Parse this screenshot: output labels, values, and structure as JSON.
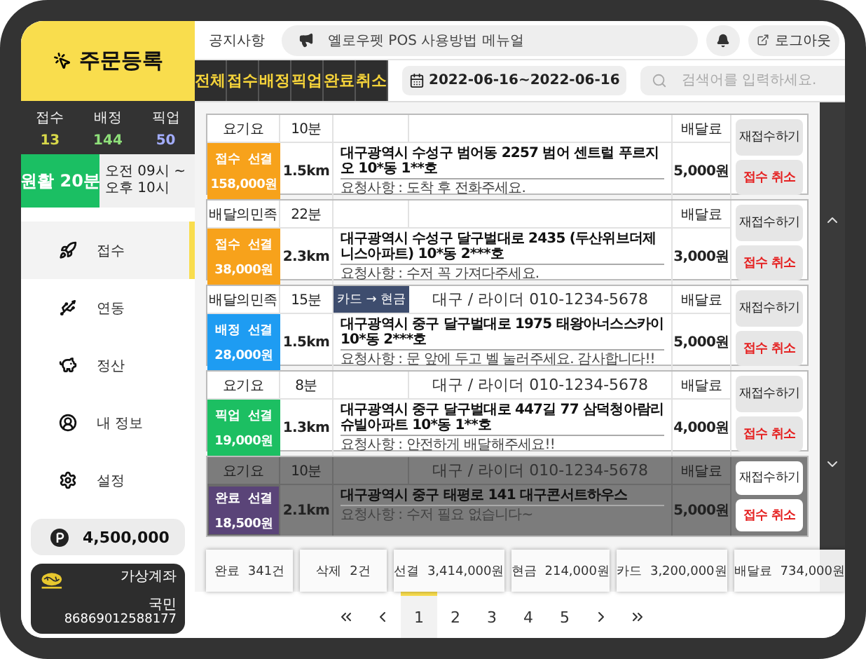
{
  "sidebar": {
    "title": "주문등록",
    "stats": [
      {
        "label": "접수",
        "value": "13",
        "color": "#d9d94a"
      },
      {
        "label": "배정",
        "value": "144",
        "color": "#8fe07a"
      },
      {
        "label": "픽업",
        "value": "50",
        "color": "#a3adff"
      }
    ],
    "traffic": {
      "label": "원활 20분",
      "hours": "오전 09시 ~ 오후 10시"
    },
    "menu": [
      {
        "kind": "receive",
        "label": "접수",
        "selected": true
      },
      {
        "kind": "link",
        "label": "연동",
        "selected": false
      },
      {
        "kind": "settle",
        "label": "정산",
        "selected": false
      },
      {
        "kind": "profile",
        "label": "내 정보",
        "selected": false
      },
      {
        "kind": "settings",
        "label": "설정",
        "selected": false
      }
    ],
    "points": "4,500,000",
    "account": {
      "title": "가상계좌",
      "bank": "국민",
      "number": "86869012588177"
    }
  },
  "header": {
    "notice_label": "공지사항",
    "notice": "옐로우펫 POS 사용방법 메뉴얼",
    "logout": "로그아웃"
  },
  "tabs": [
    "전체",
    "접수",
    "배정",
    "픽업",
    "완료",
    "취소"
  ],
  "date_range": "2022-06-16~2022-06-16",
  "search": {
    "placeholder": "검색어를 입력하세요."
  },
  "orders": [
    {
      "platform": "요기요",
      "time": "10분",
      "status": "접수",
      "payment": "선결",
      "amount": "158,000원",
      "color": "#f7a21b",
      "distance": "1.5km",
      "address": "대구광역시 수성구 범어동 2257 범어 센트럴 푸르지오 10*동 1**호",
      "request": "요청사항 : 도착 후 전화주세요.",
      "fee_label": "배달료",
      "fee": "5,000원",
      "reaccept": "재접수하기",
      "cancel": "접수 취소",
      "dimmed": false
    },
    {
      "platform": "배달의민족",
      "time": "22분",
      "status": "접수",
      "payment": "선결",
      "amount": "38,000원",
      "color": "#f7a21b",
      "distance": "2.3km",
      "address": "대구광역시 수성구 달구벌대로 2435 (두산위브더제니스아파트) 10*동 2***호",
      "request": "요청사항 : 수저 꼭 가져다주세요.",
      "fee_label": "배달료",
      "fee": "3,000원",
      "reaccept": "재접수하기",
      "cancel": "접수 취소",
      "dimmed": false
    },
    {
      "platform": "배달의민족",
      "time": "15분",
      "payment_change": "카드 → 현금",
      "rider": "대구 / 라이더 010-1234-5678",
      "status": "배정",
      "payment": "선결",
      "amount": "28,000원",
      "color": "#1e9cf2",
      "distance": "1.5km",
      "address": "대구광역시 중구 달구벌대로 1975 태왕아너스스카이 10*동 2***호",
      "request": "요청사항 : 문 앞에 두고 벨 눌러주세요. 감사합니다!!",
      "fee_label": "배달료",
      "fee": "5,000원",
      "reaccept": "재접수하기",
      "cancel": "접수 취소",
      "dimmed": false
    },
    {
      "platform": "요기요",
      "time": "8분",
      "rider": "대구 / 라이더 010-1234-5678",
      "status": "픽업",
      "payment": "선결",
      "amount": "19,000원",
      "color": "#1cbf62",
      "distance": "1.3km",
      "address": "대구광역시 중구 달구벌대로 447길 77 삼덕청아람리슈빌아파트 10*동 1**호",
      "request": "요청사항 : 안전하게 배달해주세요!!",
      "fee_label": "배달료",
      "fee": "4,000원",
      "reaccept": "재접수하기",
      "cancel": "접수 취소",
      "dimmed": false
    },
    {
      "platform": "요기요",
      "time": "10분",
      "rider": "대구 / 라이더 010-1234-5678",
      "status": "완료",
      "payment": "선결",
      "amount": "18,500원",
      "color": "#5a4478",
      "distance": "2.1km",
      "address": "대구광역시 중구 태평로 141 대구콘서트하우스",
      "request": "요청사항 : 수저 필요 없습니다~",
      "fee_label": "배달료",
      "fee": "5,000원",
      "reaccept": "재접수하기",
      "cancel": "접수 취소",
      "dimmed": true
    }
  ],
  "summary": [
    {
      "label": "완료",
      "value": "341건"
    },
    {
      "label": "삭제",
      "value": "2건"
    },
    {
      "label": "선결",
      "value": "3,414,000원"
    },
    {
      "label": "현금",
      "value": "214,000원"
    },
    {
      "label": "카드",
      "value": "3,200,000원"
    },
    {
      "label": "배달료",
      "value": "734,000원"
    }
  ],
  "pagination": [
    {
      "label": "1",
      "selected": true
    },
    {
      "label": "2",
      "selected": false
    },
    {
      "label": "3",
      "selected": false
    },
    {
      "label": "4",
      "selected": false
    },
    {
      "label": "5",
      "selected": false
    }
  ]
}
